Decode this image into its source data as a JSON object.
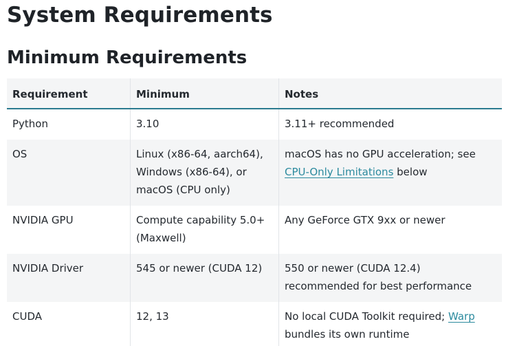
{
  "title": "System Requirements",
  "section_title": "Minimum Requirements",
  "table": {
    "headers": [
      "Requirement",
      "Minimum",
      "Notes"
    ],
    "rows": [
      {
        "requirement": "Python",
        "minimum": "3.10",
        "notes": "3.11+ recommended"
      },
      {
        "requirement": "OS",
        "minimum": "Linux (x86-64, aarch64), Windows (x86-64), or macOS (CPU only)",
        "notes_pre": "macOS has no GPU acceleration; see ",
        "notes_link": "CPU-Only Limitations",
        "notes_post": " below"
      },
      {
        "requirement": "NVIDIA GPU",
        "minimum": "Compute capability 5.0+ (Maxwell)",
        "notes": "Any GeForce GTX 9xx or newer"
      },
      {
        "requirement": "NVIDIA Driver",
        "minimum": "545 or newer (CUDA 12)",
        "notes": "550 or newer (CUDA 12.4) recommended for best performance"
      },
      {
        "requirement": "CUDA",
        "minimum": "12, 13",
        "notes_pre": "No local CUDA Toolkit required; ",
        "notes_link": "Warp",
        "notes_post": " bundles its own runtime"
      }
    ]
  },
  "colors": {
    "link": "#2b8a9e",
    "header_rule": "#2a7a8f",
    "stripe": "#f4f5f6"
  }
}
